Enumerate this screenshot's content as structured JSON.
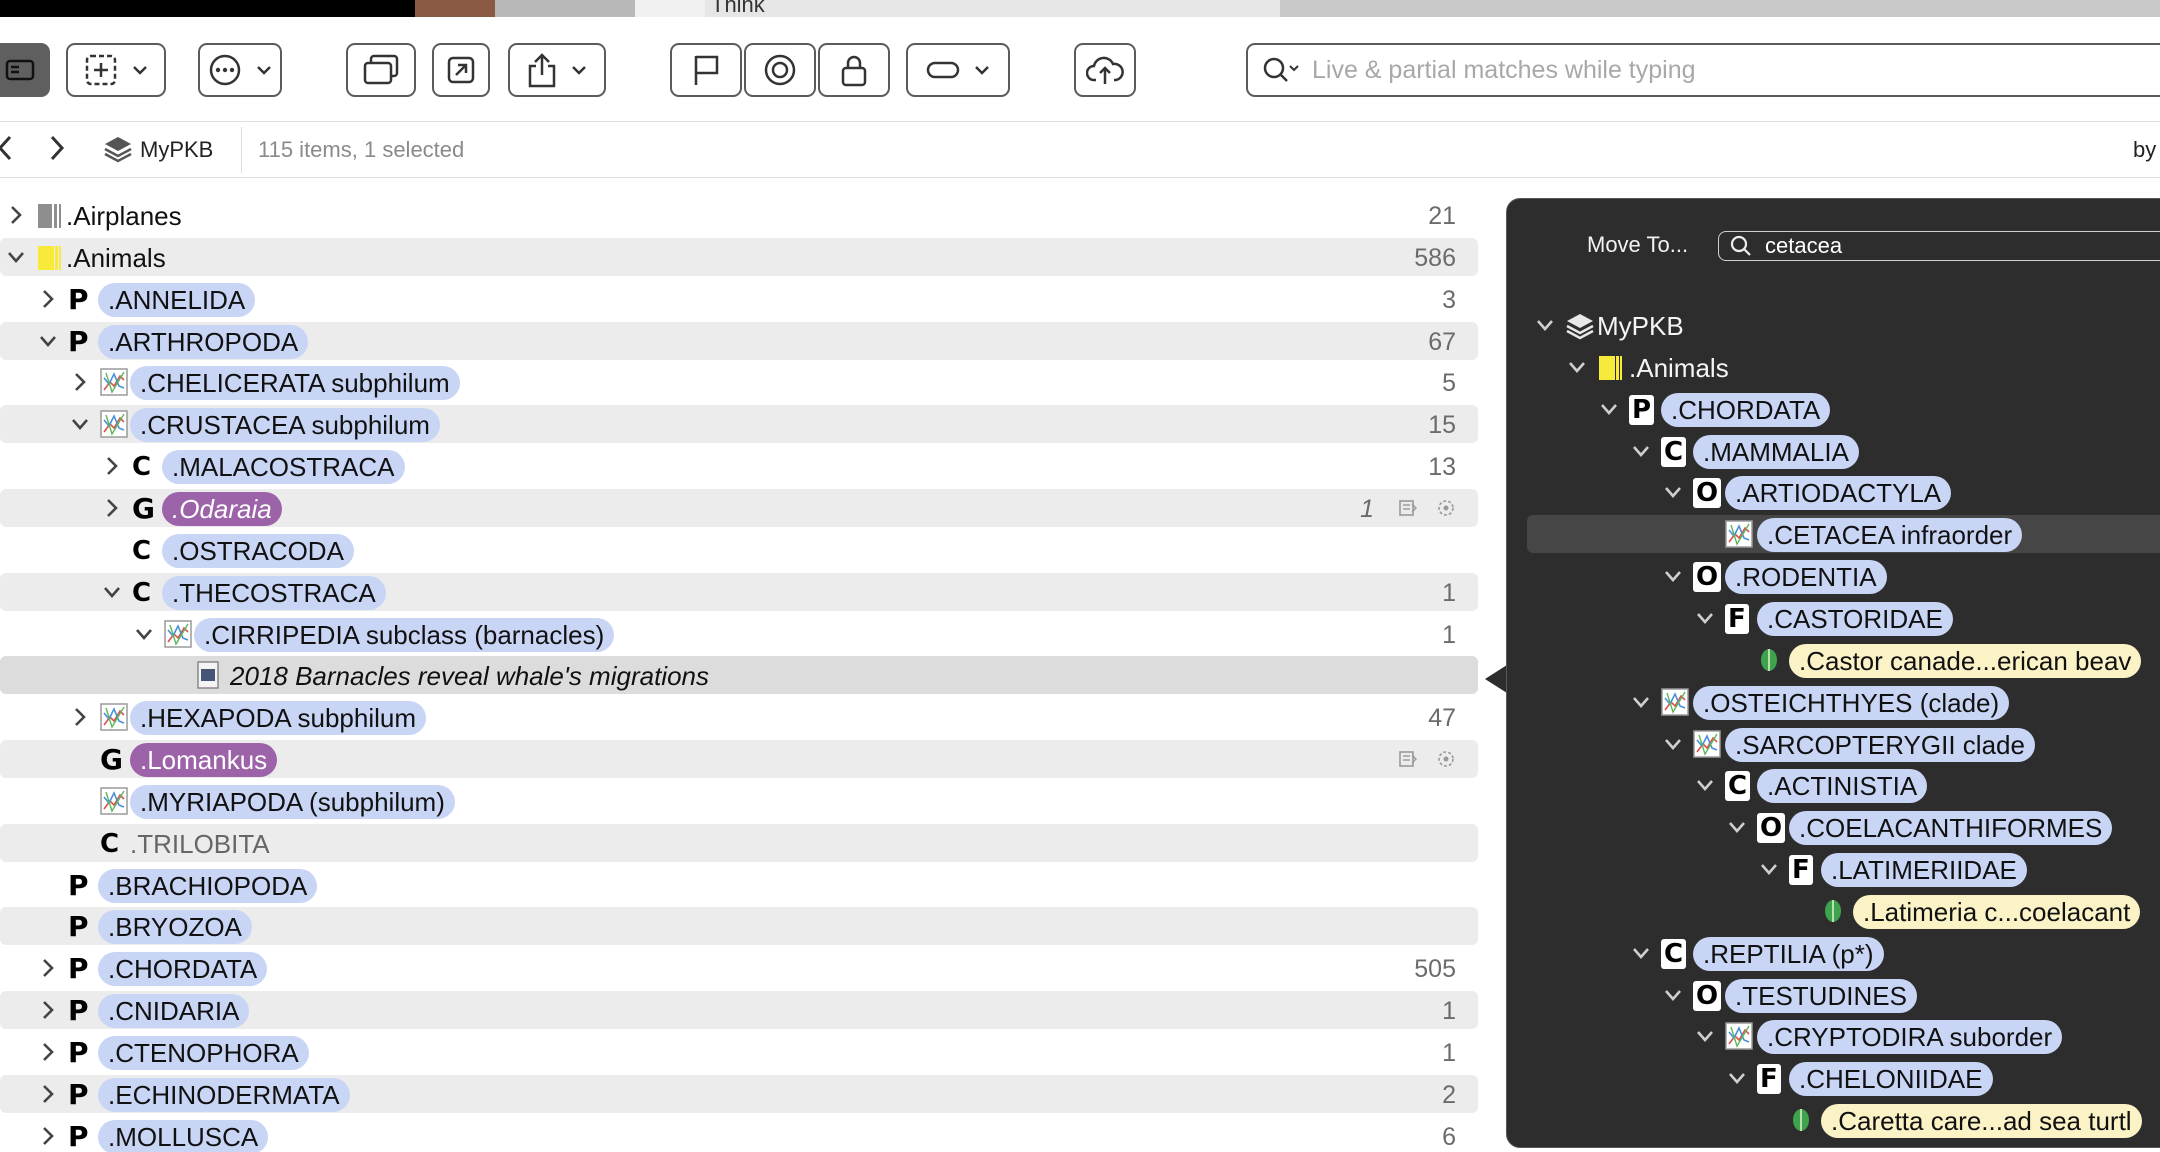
{
  "window": {
    "title_fragment": "Think"
  },
  "toolbar": {
    "search_placeholder": "Live & partial matches while typing"
  },
  "pathbar": {
    "database": "MyPKB",
    "status": "115 items, 1 selected",
    "sort_prefix": "by"
  },
  "outline": [
    {
      "label": ".Airplanes",
      "count": "21",
      "kind": "folder-gray",
      "expandable": true,
      "expanded": false,
      "indent": 0
    },
    {
      "label": ".Animals",
      "count": "586",
      "kind": "folder-yellow",
      "expandable": true,
      "expanded": true,
      "indent": 0
    },
    {
      "label": ".ANNELIDA",
      "count": "3",
      "kind": "P",
      "expandable": true,
      "expanded": false,
      "indent": 1
    },
    {
      "label": ".ARTHROPODA",
      "count": "67",
      "kind": "P",
      "expandable": true,
      "expanded": true,
      "indent": 1
    },
    {
      "label": ".CHELICERATA subphilum",
      "count": "5",
      "kind": "tree",
      "expandable": true,
      "expanded": false,
      "indent": 2
    },
    {
      "label": ".CRUSTACEA subphilum",
      "count": "15",
      "kind": "tree",
      "expandable": true,
      "expanded": true,
      "indent": 2
    },
    {
      "label": ".MALACOSTRACA",
      "count": "13",
      "kind": "C",
      "expandable": true,
      "expanded": false,
      "indent": 3
    },
    {
      "label": ".Odaraia",
      "count": "1",
      "kind": "G",
      "expandable": true,
      "expanded": false,
      "indent": 3,
      "style": "purple"
    },
    {
      "label": ".OSTRACODA",
      "count": "",
      "kind": "C",
      "expandable": false,
      "indent": 3
    },
    {
      "label": ".THECOSTRACA",
      "count": "1",
      "kind": "C",
      "expandable": true,
      "expanded": true,
      "indent": 3
    },
    {
      "label": ".CIRRIPEDIA subclass (barnacles)",
      "count": "1",
      "kind": "tree",
      "expandable": true,
      "expanded": true,
      "indent": 4
    },
    {
      "label": "2018 Barnacles reveal whale's migrations",
      "count": "",
      "kind": "doc",
      "expandable": false,
      "indent": 5,
      "style": "doc"
    },
    {
      "label": ".HEXAPODA subphilum",
      "count": "47",
      "kind": "tree",
      "expandable": true,
      "expanded": false,
      "indent": 2
    },
    {
      "label": ".Lomankus",
      "count": "",
      "kind": "G",
      "expandable": false,
      "indent": 2,
      "style": "purple"
    },
    {
      "label": ".MYRIAPODA (subphilum)",
      "count": "",
      "kind": "tree",
      "expandable": false,
      "indent": 2
    },
    {
      "label": ".TRILOBITA",
      "count": "",
      "kind": "C",
      "expandable": false,
      "indent": 2,
      "style": "plain"
    },
    {
      "label": ".BRACHIOPODA",
      "count": "",
      "kind": "P",
      "expandable": false,
      "indent": 1
    },
    {
      "label": ".BRYOZOA",
      "count": "",
      "kind": "P",
      "expandable": false,
      "indent": 1
    },
    {
      "label": ".CHORDATA",
      "count": "505",
      "kind": "P",
      "expandable": true,
      "expanded": false,
      "indent": 1
    },
    {
      "label": ".CNIDARIA",
      "count": "1",
      "kind": "P",
      "expandable": true,
      "expanded": false,
      "indent": 1
    },
    {
      "label": ".CTENOPHORA",
      "count": "1",
      "kind": "P",
      "expandable": true,
      "expanded": false,
      "indent": 1
    },
    {
      "label": ".ECHINODERMATA",
      "count": "2",
      "kind": "P",
      "expandable": true,
      "expanded": false,
      "indent": 1
    },
    {
      "label": ".MOLLUSCA",
      "count": "6",
      "kind": "P",
      "expandable": true,
      "expanded": false,
      "indent": 1
    }
  ],
  "move_to": {
    "label": "Move To...",
    "query": "cetacea",
    "tree": [
      {
        "label": "MyPKB",
        "kind": "db",
        "indent": 0,
        "expanded": true
      },
      {
        "label": ".Animals",
        "kind": "folder-yellow",
        "indent": 1,
        "expanded": true
      },
      {
        "label": ".CHORDATA",
        "kind": "P",
        "indent": 2,
        "expanded": true
      },
      {
        "label": ".MAMMALIA",
        "kind": "C",
        "indent": 3,
        "expanded": true
      },
      {
        "label": ".ARTIODACTYLA",
        "kind": "O",
        "indent": 4,
        "expanded": true
      },
      {
        "label": ".CETACEA infraorder",
        "kind": "tree",
        "indent": 5,
        "highlight": true
      },
      {
        "label": ".RODENTIA",
        "kind": "O",
        "indent": 4,
        "expanded": true
      },
      {
        "label": ".CASTORIDAE",
        "kind": "F",
        "indent": 5,
        "expanded": true
      },
      {
        "label": ".Castor canade...erican beav",
        "kind": "species",
        "indent": 6
      },
      {
        "label": ".OSTEICHTHYES (clade)",
        "kind": "tree",
        "indent": 3,
        "expanded": true
      },
      {
        "label": ".SARCOPTERYGII clade",
        "kind": "tree",
        "indent": 4,
        "expanded": true
      },
      {
        "label": ".ACTINISTIA",
        "kind": "C",
        "indent": 5,
        "expanded": true
      },
      {
        "label": ".COELACANTHIFORMES",
        "kind": "O",
        "indent": 6,
        "expanded": true
      },
      {
        "label": ".LATIMERIIDAE",
        "kind": "F",
        "indent": 7,
        "expanded": true
      },
      {
        "label": ".Latimeria c...coelacant",
        "kind": "species",
        "indent": 8
      },
      {
        "label": ".REPTILIA (p*)",
        "kind": "C",
        "indent": 3,
        "expanded": true
      },
      {
        "label": ".TESTUDINES",
        "kind": "O",
        "indent": 4,
        "expanded": true
      },
      {
        "label": ".CRYPTODIRA suborder",
        "kind": "tree",
        "indent": 5,
        "expanded": true
      },
      {
        "label": ".CHELONIIDAE",
        "kind": "F",
        "indent": 6,
        "expanded": true
      },
      {
        "label": ".Caretta care...ad sea turtl",
        "kind": "species",
        "indent": 7
      }
    ]
  },
  "colors": {
    "pill": "#c8d5f5",
    "purple": "#9c63a8",
    "species": "#fbf3c6",
    "popover": "#2d2d2d"
  }
}
